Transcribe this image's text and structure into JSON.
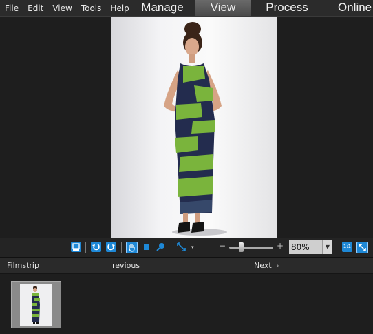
{
  "menu": [
    {
      "label": "File",
      "mnemonic": "F",
      "rest": "ile"
    },
    {
      "label": "Edit",
      "mnemonic": "E",
      "rest": "dit"
    },
    {
      "label": "View",
      "mnemonic": "V",
      "rest": "iew"
    },
    {
      "label": "Tools",
      "mnemonic": "T",
      "rest": "ools"
    },
    {
      "label": "Help",
      "mnemonic": "H",
      "rest": "elp"
    }
  ],
  "modes": {
    "manage": "Manage",
    "view": "View",
    "process": "Process",
    "online": "Online",
    "active": "View"
  },
  "toolbar": {
    "zoom_value": "80%",
    "zoom_minus": "−",
    "zoom_plus": "+",
    "zoom_level_fraction": 0.25,
    "actual_size_label": "1:1",
    "icons": [
      "filmstrip-view-icon",
      "rotate-left-icon",
      "rotate-right-icon",
      "hand-tool-icon",
      "select-tool-icon",
      "zoom-tool-icon",
      "full-screen-icon",
      "fit-window-icon"
    ]
  },
  "filmstrip": {
    "label": "Filmstrip",
    "previous": "revious",
    "next": "Next",
    "next_icon": "chevron-right-icon"
  },
  "colors": {
    "accent": "#1e88d6",
    "dress_green": "#7ab43c",
    "dress_navy": "#232c4e"
  }
}
